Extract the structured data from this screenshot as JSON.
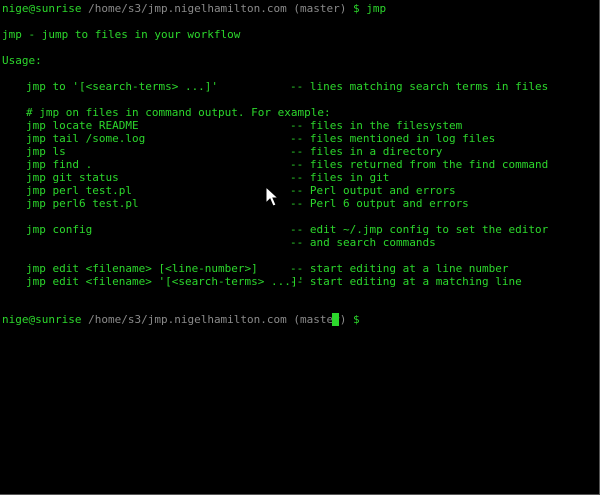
{
  "prompt1": {
    "user_host": "nige@sunrise",
    "path": "/home/s3/jmp.nigelhamilton.com",
    "branch": "(master)",
    "dollar": "$",
    "command": "jmp"
  },
  "title_line": "jmp - jump to files in your workflow",
  "usage_label": "Usage:",
  "usage_lines": [
    {
      "cmd": "jmp to '[<search-terms> ...]'",
      "desc": "-- lines matching search terms in files"
    },
    {
      "cmd": "# jmp on files in command output. For example:",
      "desc": ""
    },
    {
      "cmd": "jmp locate README",
      "desc": "-- files in the filesystem"
    },
    {
      "cmd": "jmp tail /some.log",
      "desc": "-- files mentioned in log files"
    },
    {
      "cmd": "jmp ls",
      "desc": "-- files in a directory"
    },
    {
      "cmd": "jmp find .",
      "desc": "-- files returned from the find command"
    },
    {
      "cmd": "jmp git status",
      "desc": "-- files in git"
    },
    {
      "cmd": "jmp perl test.pl",
      "desc": "-- Perl output and errors"
    },
    {
      "cmd": "jmp perl6 test.pl",
      "desc": "-- Perl 6 output and errors"
    },
    {
      "cmd": "jmp config",
      "desc": "-- edit ~/.jmp config to set the editor"
    },
    {
      "cmd": "",
      "desc": "-- and search commands"
    },
    {
      "cmd": "jmp edit <filename> [<line-number>]",
      "desc": "-- start editing at a line number"
    },
    {
      "cmd": "jmp edit <filename> '[<search-terms> ...]'",
      "desc": "-- start editing at a matching line"
    }
  ],
  "prompt2": {
    "user_host": "nige@sunrise",
    "path": "/home/s3/jmp.nigelhamilton.com",
    "branch": "(master)",
    "dollar": "$"
  },
  "colors": {
    "background": "#000000",
    "text_green": "#2cd72c",
    "path_grey": "#8a8a8a"
  },
  "icons": {
    "cursor": "block-cursor",
    "pointer": "mouse-pointer-icon"
  }
}
